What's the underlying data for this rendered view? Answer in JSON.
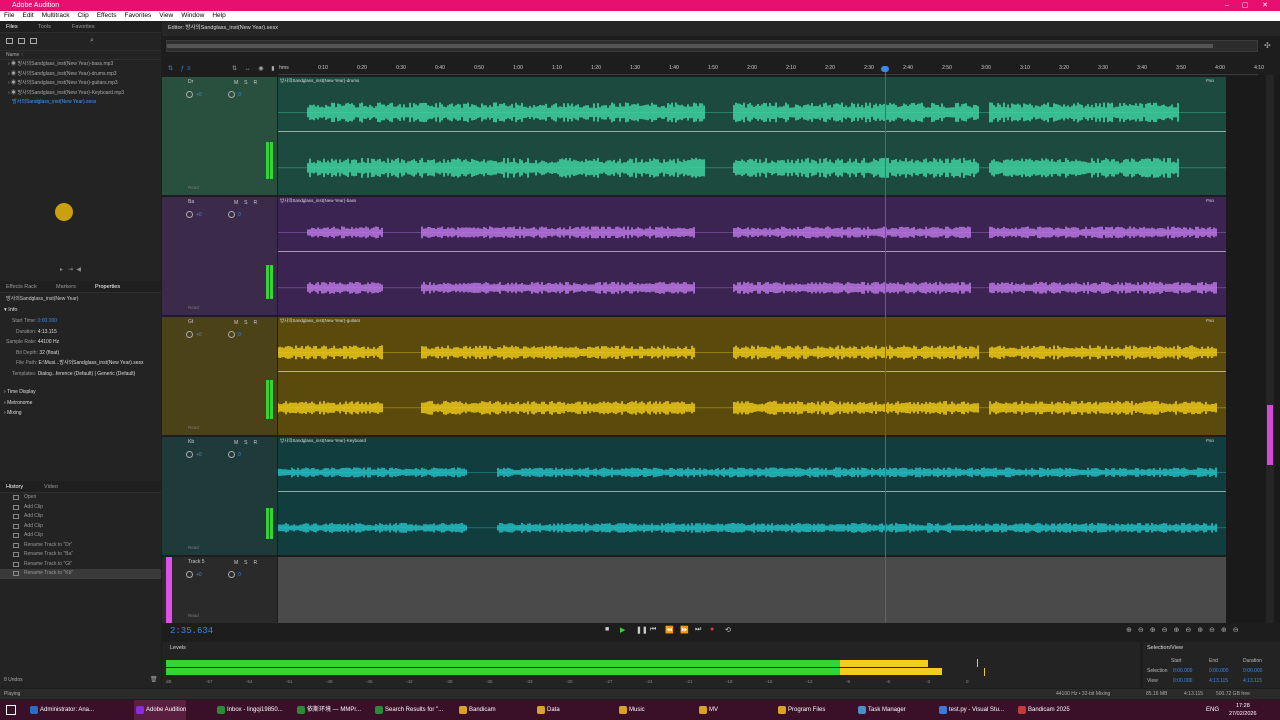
{
  "app": {
    "title": "Adobe Audition"
  },
  "menu": [
    "File",
    "Edit",
    "Multitrack",
    "Clip",
    "Effects",
    "Favorites",
    "View",
    "Window",
    "Help"
  ],
  "files_panel": {
    "tabs": [
      "Files",
      "Tools",
      "Favorites"
    ],
    "column_header": "Name ↑",
    "items": [
      "방사의Sandglass_inst(New Year)-bass.mp3",
      "방사의Sandglass_inst(New Year)-drums.mp3",
      "방사의Sandglass_inst(New Year)-guitars.mp3",
      "방사의Sandglass_inst(New Year)-Keyboard.mp3",
      "방사의Sandglass_inst(New Year).sesx"
    ]
  },
  "properties_panel": {
    "tabs": [
      "Effects Rack",
      "Markers",
      "Properties"
    ],
    "session_name": "방사의Sandglass_inst(New Year)",
    "section_info": "Info",
    "start_time_label": "Start Time:",
    "start_time": "0:00.000",
    "duration_label": "Duration:",
    "duration": "4:13.115",
    "sample_rate_label": "Sample Rate:",
    "sample_rate": "44100 Hz",
    "bit_depth_label": "Bit Depth:",
    "bit_depth": "32 (float)",
    "file_path_label": "File Path:",
    "file_path": "E:\\Musi...방사의Sandglass_inst(New Year).sesx",
    "templates_label": "Templates:",
    "templates": "Dialog...ference (Default) | Generic (Default)",
    "sections": [
      "Time Display",
      "Metronome",
      "Mixing"
    ]
  },
  "history_panel": {
    "tabs": [
      "History",
      "Video"
    ],
    "items": [
      "Open",
      "Add Clip",
      "Add Clip",
      "Add Clip",
      "Add Clip",
      "Rename Track to \"Dr\"",
      "Rename Track to \"Ba\"",
      "Rename Track to \"Gt\"",
      "Rename Track to \"Kb\""
    ],
    "undo_count": "8 Undos"
  },
  "editor": {
    "tab_title": "Editor: 방사의Sandglass_inst(New Year).sesx",
    "ruler_ticks": [
      "hms",
      "0:10",
      "0:20",
      "0:30",
      "0:40",
      "0:50",
      "1:00",
      "1:10",
      "1:20",
      "1:30",
      "1:40",
      "1:50",
      "2:00",
      "2:10",
      "2:20",
      "2:30",
      "2:40",
      "2:50",
      "3:00",
      "3:10",
      "3:20",
      "3:30",
      "3:40",
      "3:50",
      "4:00",
      "4:10"
    ],
    "tracks": [
      {
        "name": "Dr",
        "clip": "방사의Sandglass_inst(New Year)-drums",
        "bg": "#1c4a3e",
        "wave": "#3fd9a4",
        "header": "#29503f"
      },
      {
        "name": "Ba",
        "clip": "방사의Sandglass_inst(New Year)-bass",
        "bg": "#3b2352",
        "wave": "#c07ae8",
        "header": "#3c2a4b"
      },
      {
        "name": "Gt",
        "clip": "방사의Sandglass_inst(New Year)-guitars",
        "bg": "#5a4b0c",
        "wave": "#f2cd1a",
        "header": "#4b4218"
      },
      {
        "name": "Kb",
        "clip": "방사의Sandglass_inst(New Year)-Keyboard",
        "bg": "#113d3e",
        "wave": "#25c4c9",
        "header": "#1e3b3a"
      },
      {
        "name": "Track 5",
        "clip": "",
        "bg": "#4a4a4a",
        "wave": "",
        "header": "#2a2a2a"
      }
    ],
    "track_controls": {
      "m": "M",
      "s": "S",
      "r": "R",
      "vol": "+0",
      "pan": "0",
      "read": "Read",
      "mode": "Mix",
      "pan_label": "Pan"
    }
  },
  "transport": {
    "timecode": "2:35.634"
  },
  "levels": {
    "title": "Levels",
    "scale": [
      "dB",
      "-57",
      "-54",
      "-51",
      "-48",
      "-45",
      "-42",
      "-39",
      "-36",
      "-33",
      "-30",
      "-27",
      "-24",
      "-21",
      "-18",
      "-15",
      "-12",
      "-9",
      "-6",
      "-3",
      "0"
    ]
  },
  "selection_view": {
    "title": "Selection/View",
    "headers": [
      "Start",
      "End",
      "Duration"
    ],
    "selection_label": "Selection",
    "selection": [
      "0:00.000",
      "0:00.000",
      "0:00.000"
    ],
    "view_label": "View",
    "view": [
      "0:00.000",
      "4:13.115",
      "4:13.115"
    ]
  },
  "status": {
    "left": "Playing",
    "sample": "44100 Hz • 32-bit Mixing",
    "memory": "85.16 MB",
    "duration": "4:13.115",
    "free": "500.72 GB free"
  },
  "taskbar": {
    "items": [
      "Administrator: Ana...",
      "Adobe Audition",
      "Inbox - lingqi19850...",
      "依斯环境 — MMPr...",
      "Search Results for \"...",
      "Bandicam",
      "Data",
      "Music",
      "MV",
      "Program Files",
      "Task Manager",
      "test.py - Visual Stu...",
      "Bandicam 2025"
    ],
    "lang": "ENG",
    "time": "17:28",
    "date": "27/02/2026"
  },
  "colors": {
    "title_bar": "#e8106e",
    "accent": "#3a8ae8",
    "meter_green": "#35d435",
    "meter_yellow": "#f2cd1a"
  }
}
